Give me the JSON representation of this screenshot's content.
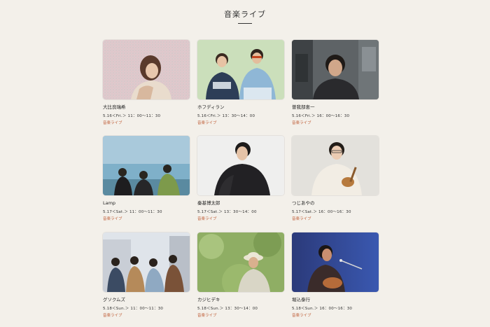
{
  "section": {
    "title": "音楽ライブ"
  },
  "artists": [
    {
      "name": "大比良瑞希",
      "time": "5.16＜Fri.＞ 11：00〜11：30",
      "tag": "音楽ライブ",
      "photo": "portrait-woman"
    },
    {
      "name": "ホフディラン",
      "time": "5.16＜Fri.＞ 13：30〜14：00",
      "tag": "音楽ライブ",
      "photo": "duo-green"
    },
    {
      "name": "曽我部恵一",
      "time": "5.16＜Fri.＞ 16：00〜16：30",
      "tag": "音楽ライブ",
      "photo": "street-man"
    },
    {
      "name": "Lamp",
      "time": "5.17＜Sat.＞ 11：00〜11：30",
      "tag": "音楽ライブ",
      "photo": "trio-sky"
    },
    {
      "name": "秦基博太郎",
      "time": "5.17＜Sat.＞ 13：30〜14：00",
      "tag": "音楽ライブ",
      "photo": "man-white"
    },
    {
      "name": "つじあやの",
      "time": "5.17＜Sat.＞ 16：00〜16：30",
      "tag": "音楽ライブ",
      "photo": "ukulele"
    },
    {
      "name": "グソクムズ",
      "time": "5.18＜Sun.＞ 11：00〜11：30",
      "tag": "音楽ライブ",
      "photo": "quartet"
    },
    {
      "name": "カジヒデキ",
      "time": "5.18＜Sun.＞ 13：30〜14：00",
      "tag": "音楽ライブ",
      "photo": "hat-garden"
    },
    {
      "name": "堀込泰行",
      "time": "5.18＜Sun.＞ 16：00〜16：30",
      "tag": "音楽ライブ",
      "photo": "guitar-blue"
    }
  ]
}
